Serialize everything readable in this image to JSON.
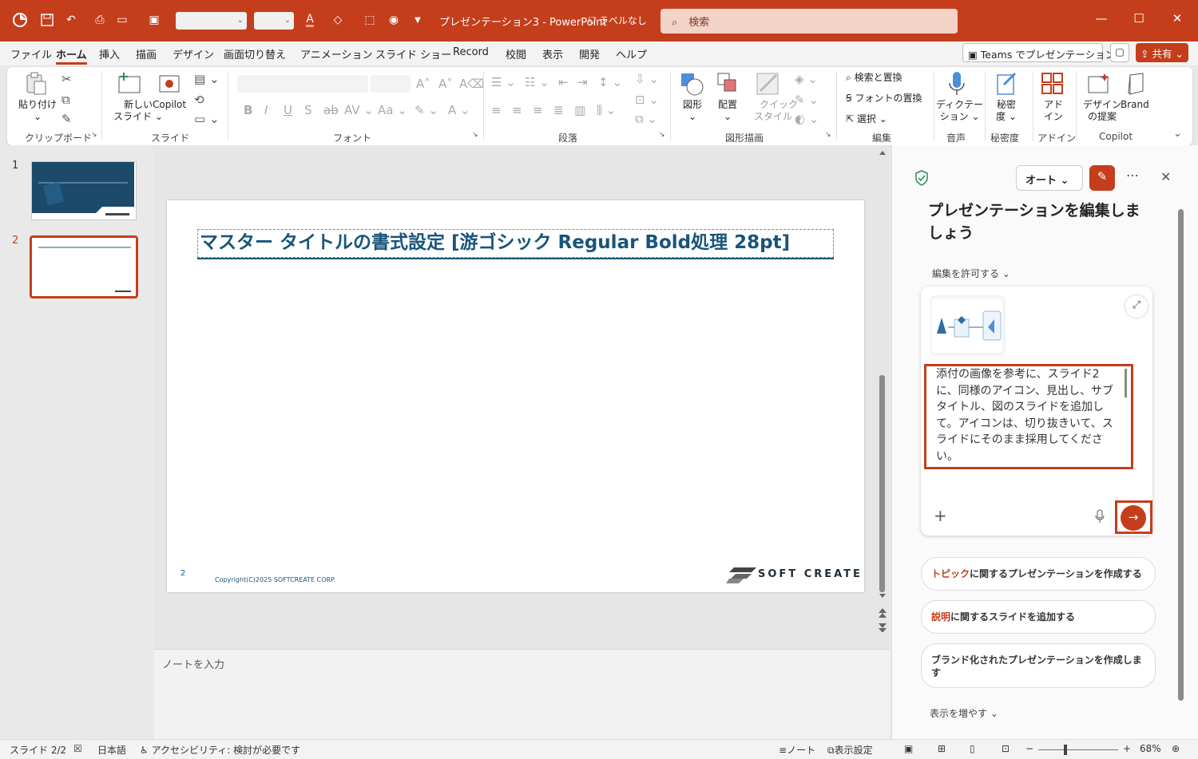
{
  "app": {
    "title": "プレゼンテーション3 - PowerPoint",
    "sensitivity_label": "ラベルなし",
    "search_placeholder": "検索"
  },
  "menu_tabs": [
    "ファイル",
    "ホーム",
    "挿入",
    "描画",
    "デザイン",
    "画面切り替え",
    "アニメーション",
    "スライド ショー",
    "Record",
    "校閲",
    "表示",
    "開発",
    "ヘルプ"
  ],
  "active_tab": "ホーム",
  "header_buttons": {
    "teams": "Teams でプレゼンテーション",
    "share": "共有"
  },
  "ribbon": {
    "clipboard": {
      "paste": "貼り付け",
      "group": "クリップボード"
    },
    "slides": {
      "new_slide_1": "新しい",
      "new_slide_2": "スライド",
      "copilot": "Copilot",
      "group": "スライド"
    },
    "font": {
      "group": "フォント"
    },
    "paragraph": {
      "group": "段落"
    },
    "drawing": {
      "shapes": "図形",
      "arrange": "配置",
      "quick_1": "クイック",
      "quick_2": "スタイル",
      "group": "図形描画"
    },
    "editing": {
      "find": "検索と置換",
      "replace_font": "フォントの置換",
      "select": "選択",
      "group": "編集"
    },
    "voice": {
      "dictate_1": "ディクテー",
      "dictate_2": "ション",
      "group": "音声"
    },
    "sensitivity": {
      "label_1": "秘密",
      "label_2": "度",
      "group": "秘密度"
    },
    "addins": {
      "label_1": "アド",
      "label_2": "イン",
      "group": "アドイン"
    },
    "copilot": {
      "designer_1": "デザイン",
      "designer_2": "の提案",
      "brand": "Brand",
      "group": "Copilot"
    }
  },
  "thumbnails": [
    {
      "number": "1"
    },
    {
      "number": "2"
    }
  ],
  "slide": {
    "title": "マスター タイトルの書式設定 [游ゴシック Regular Bold処理 28pt]",
    "number": "2",
    "copyright": "Copyright(C)2025 SOFTCREATE CORP.",
    "logo_text": "SOFT CREATE"
  },
  "notes_placeholder": "ノートを入力",
  "copilot": {
    "mode": "オート",
    "heading": "プレゼンテーションを編集しましょう",
    "allow_edit": "編集を許可する",
    "prompt": "添付の画像を参考に、スライド2に、同様のアイコン、見出し、サブタイトル、図のスライドを追加して。アイコンは、切り抜きいて、スライドにそのまま採用してください。",
    "suggestions": [
      {
        "highlight": "トピック",
        "rest": "に関するプレゼンテーションを作成する"
      },
      {
        "highlight": "説明",
        "rest": "に関するスライドを追加する"
      },
      {
        "highlight": "",
        "rest": "ブランド化されたプレゼンテーションを作成します"
      }
    ],
    "show_more": "表示を増やす"
  },
  "status": {
    "slide": "スライド 2/2",
    "language": "日本語",
    "accessibility": "アクセシビリティ: 検討が必要です",
    "notes": "ノート",
    "display": "表示設定",
    "zoom": "68%"
  },
  "colors": {
    "accent": "#c43e1c",
    "slide_title": "#18557a"
  }
}
